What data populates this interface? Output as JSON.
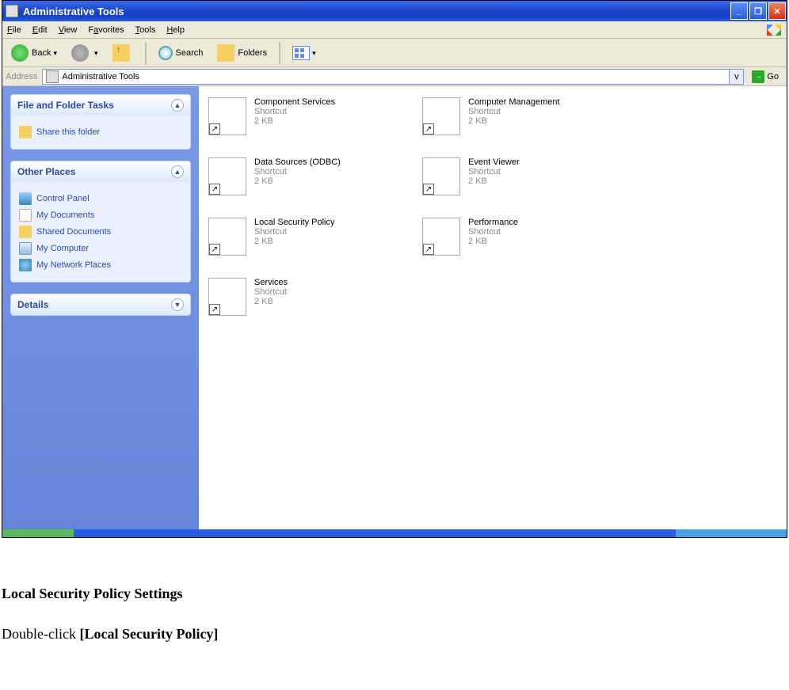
{
  "window": {
    "title": "Administrative Tools"
  },
  "menu": {
    "file": "File",
    "edit": "Edit",
    "view": "View",
    "favorites": "Favorites",
    "tools": "Tools",
    "help": "Help"
  },
  "toolbar": {
    "back": "Back",
    "search": "Search",
    "folders": "Folders"
  },
  "addressbar": {
    "label": "Address",
    "value": "Administrative Tools",
    "go": "Go"
  },
  "sidebar": {
    "tasks": {
      "title": "File and Folder Tasks",
      "share": "Share this folder"
    },
    "places": {
      "title": "Other Places",
      "items": [
        "Control Panel",
        "My Documents",
        "Shared Documents",
        "My Computer",
        "My Network Places"
      ]
    },
    "details": {
      "title": "Details"
    }
  },
  "content": {
    "type_label": "Shortcut",
    "size_label": "2 KB",
    "items": [
      {
        "name": "Component Services"
      },
      {
        "name": "Computer Management"
      },
      {
        "name": "Data Sources (ODBC)"
      },
      {
        "name": "Event Viewer"
      },
      {
        "name": "Local Security Policy"
      },
      {
        "name": "Performance"
      },
      {
        "name": "Services"
      }
    ]
  },
  "doc": {
    "heading": "Local Security Policy Settings",
    "line_prefix": "Double-click ",
    "line_bold": "[Local Security Policy]"
  }
}
